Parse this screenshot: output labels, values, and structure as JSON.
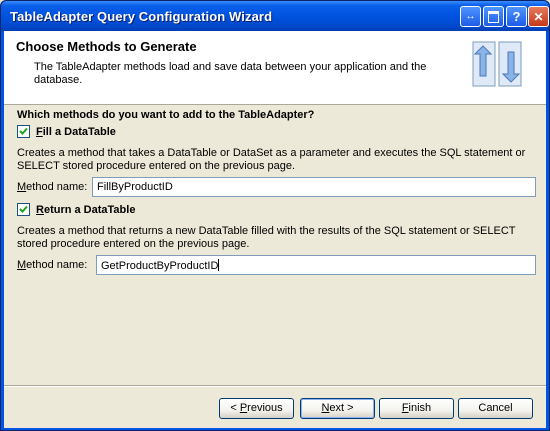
{
  "window": {
    "title": "TableAdapter Query Configuration Wizard",
    "controls": {
      "help": "↔",
      "restore": "",
      "question": "?",
      "close": "✕"
    }
  },
  "header": {
    "title": "Choose Methods to Generate",
    "description": "The TableAdapter methods load and save data between your application and the database."
  },
  "question": "Which methods do you want to add to the TableAdapter?",
  "fill": {
    "checked": true,
    "label_accel": "F",
    "label_rest": "ill a DataTable",
    "description": "Creates a method that takes a DataTable or DataSet as a parameter and executes the SQL statement or SELECT stored procedure entered on the previous page.",
    "method_label_accel": "M",
    "method_label_rest": "ethod name:",
    "method_value": "FillByProductID"
  },
  "return": {
    "checked": true,
    "label_accel": "R",
    "label_rest": "eturn a DataTable",
    "description": "Creates a method that returns a new DataTable filled with the results of the SQL statement or SELECT stored procedure entered on the previous page.",
    "method_label_accel": "M",
    "method_label_rest": "ethod name:",
    "method_value": "GetProductByProductID"
  },
  "buttons": {
    "previous": {
      "prefix": "< ",
      "accel": "P",
      "rest": "revious"
    },
    "next": {
      "accel": "N",
      "rest": "ext >"
    },
    "finish": {
      "accel": "F",
      "rest": "inish"
    },
    "cancel": {
      "label": "Cancel"
    }
  }
}
